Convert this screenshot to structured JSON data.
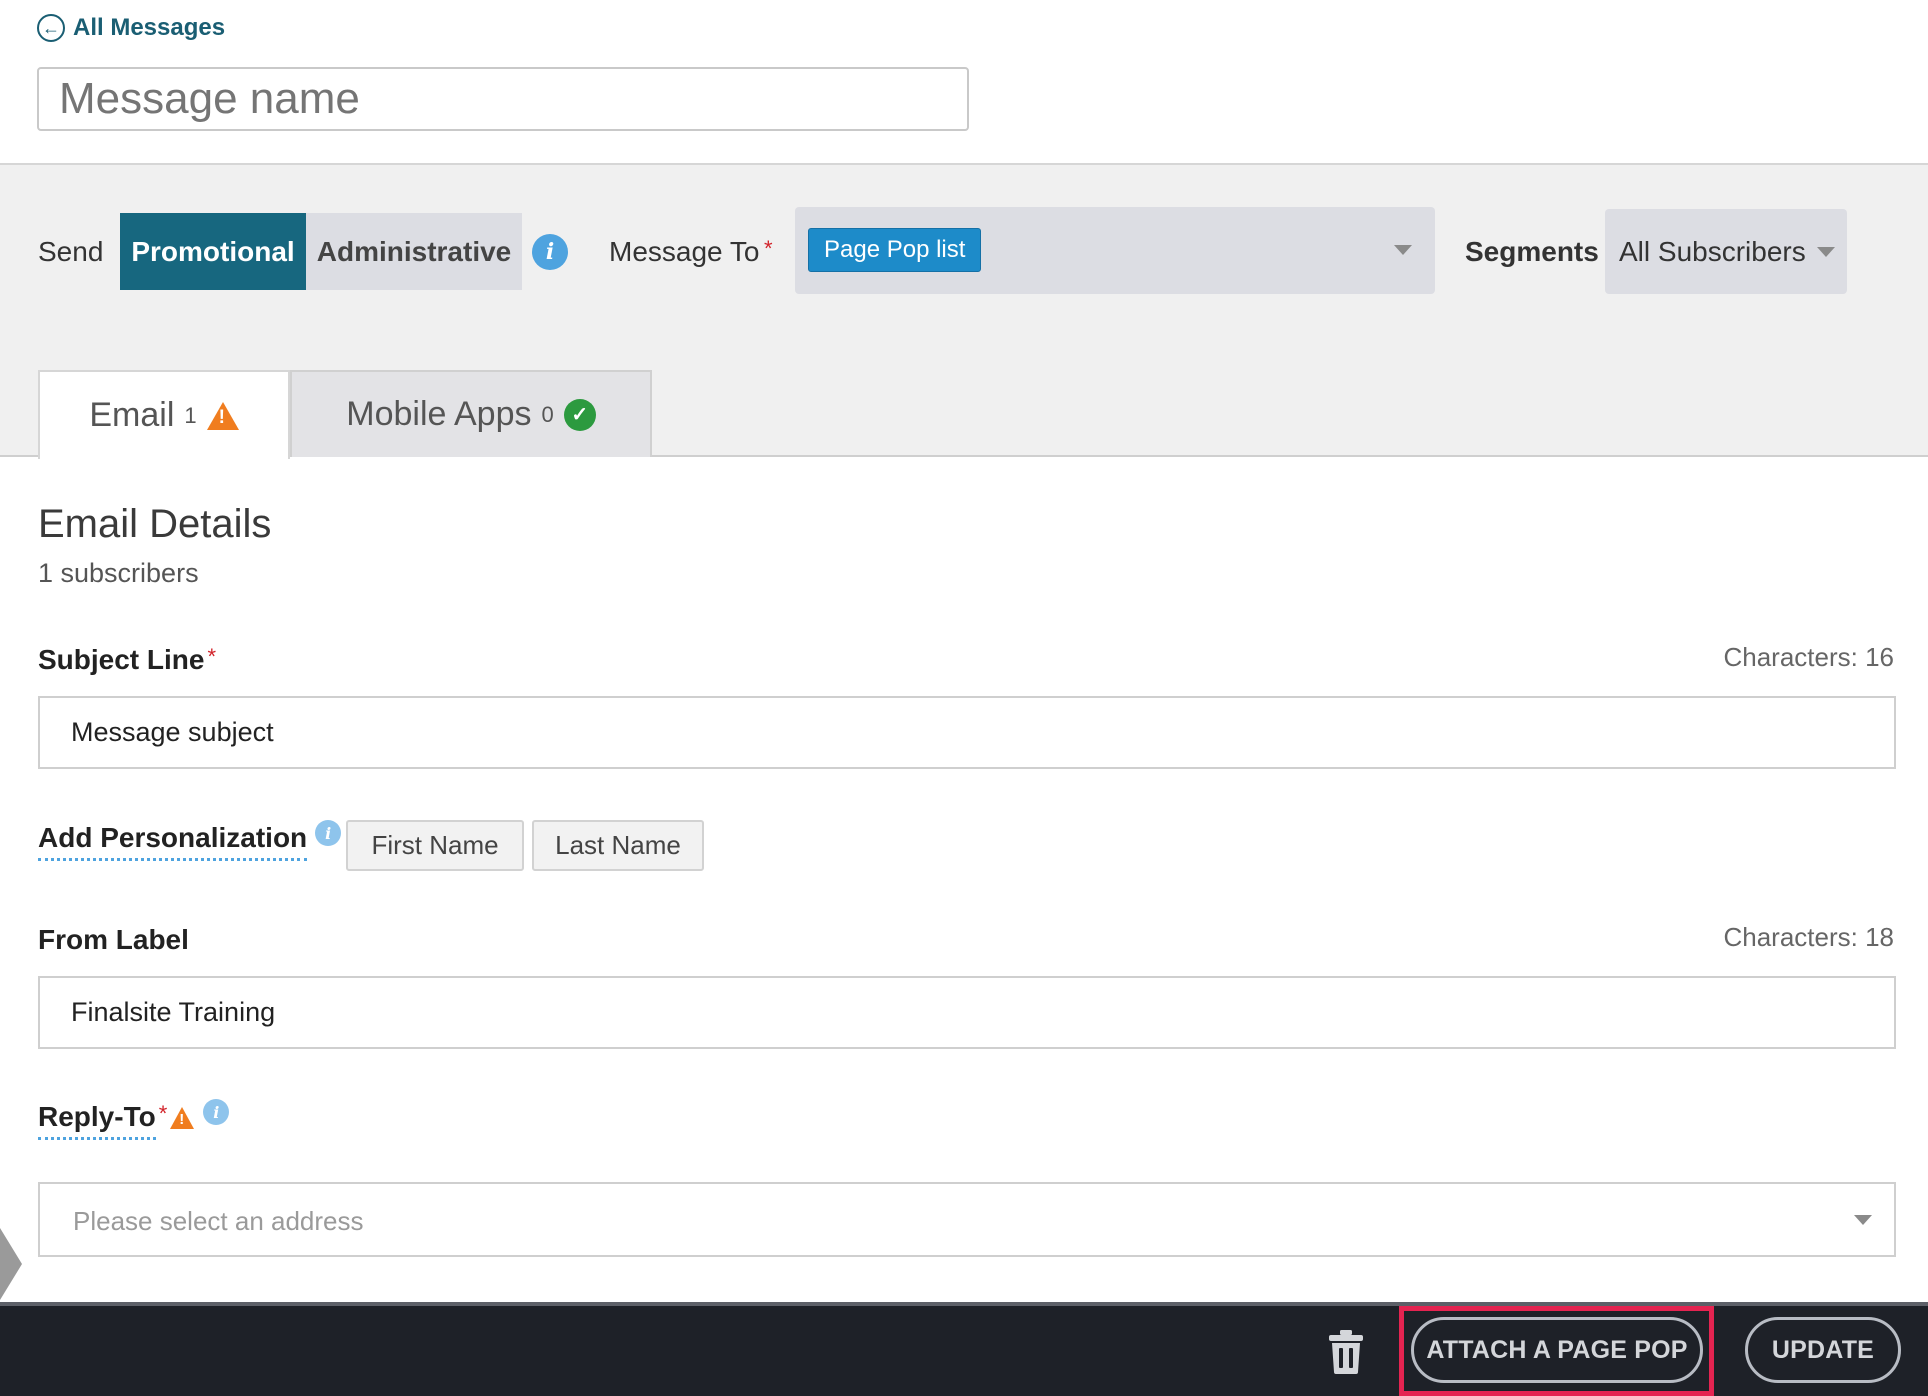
{
  "header": {
    "back_label": "All Messages",
    "message_name_placeholder": "Message name"
  },
  "send_bar": {
    "send_label": "Send",
    "promotional_label": "Promotional",
    "administrative_label": "Administrative",
    "message_to_label": "Message To",
    "required_mark": "*",
    "message_to_tag": "Page Pop list",
    "segments_label": "Segments",
    "segments_value": "All Subscribers",
    "active_color": "#17677f"
  },
  "tabs": [
    {
      "label": "Email",
      "count": "1",
      "status": "warning"
    },
    {
      "label": "Mobile Apps",
      "count": "0",
      "status": "ok"
    }
  ],
  "email_details": {
    "title": "Email Details",
    "subscribers": "1 subscribers",
    "subject": {
      "label": "Subject Line",
      "required": "*",
      "counter": "Characters: 16",
      "value": "Message subject"
    },
    "personalization": {
      "label": "Add Personalization",
      "buttons": [
        "First Name",
        "Last Name"
      ]
    },
    "from": {
      "label": "From Label",
      "counter": "Characters: 18",
      "value": "Finalsite Training"
    },
    "reply_to": {
      "label": "Reply-To",
      "required": "*",
      "placeholder": "Please select an address"
    }
  },
  "footer": {
    "attach_label": "ATTACH A PAGE POP",
    "update_label": "UPDATE",
    "highlight_color": "#e52451"
  },
  "icons": {
    "back": "arrow-left-circle-icon",
    "info": "info-icon",
    "warning": "warning-icon",
    "check": "check-circle-icon",
    "trash": "trash-icon",
    "dropdown": "chevron-down-icon"
  }
}
